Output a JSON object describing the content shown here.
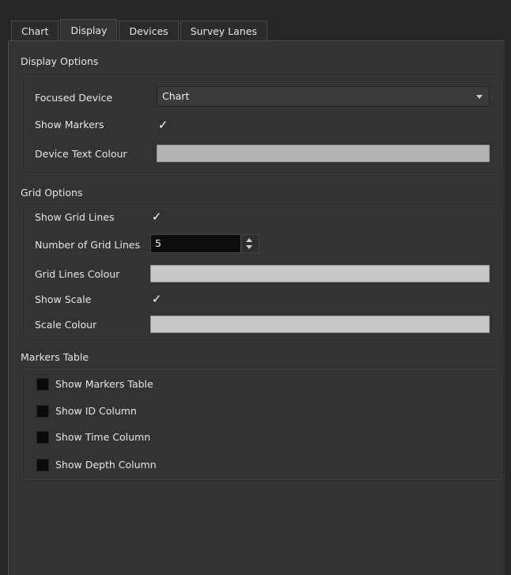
{
  "tabs": [
    "Chart",
    "Display",
    "Devices",
    "Survey Lanes"
  ],
  "active_tab": "Display",
  "display_options": {
    "title": "Display Options",
    "focused_device_label": "Focused Device",
    "focused_device_value": "Chart",
    "show_markers_label": "Show Markers",
    "show_markers_checked": true,
    "check_glyph": "✓",
    "device_text_colour_label": "Device Text Colour",
    "device_text_colour": "#b3b3b3"
  },
  "grid_options": {
    "title": "Grid Options",
    "show_grid_lines_label": "Show Grid Lines",
    "show_grid_lines_checked": true,
    "number_of_grid_lines_label": "Number of Grid Lines",
    "number_of_grid_lines_value": "5",
    "grid_lines_colour_label": "Grid Lines Colour",
    "grid_lines_colour": "#c8c8c8",
    "show_scale_label": "Show Scale",
    "show_scale_checked": true,
    "scale_colour_label": "Scale Colour",
    "scale_colour": "#c8c8c8"
  },
  "markers_table": {
    "title": "Markers Table",
    "items": [
      {
        "label": "Show Markers Table",
        "checked": false
      },
      {
        "label": "Show ID Column",
        "checked": false
      },
      {
        "label": "Show Time Column",
        "checked": false
      },
      {
        "label": "Show Depth Column",
        "checked": false
      }
    ]
  }
}
